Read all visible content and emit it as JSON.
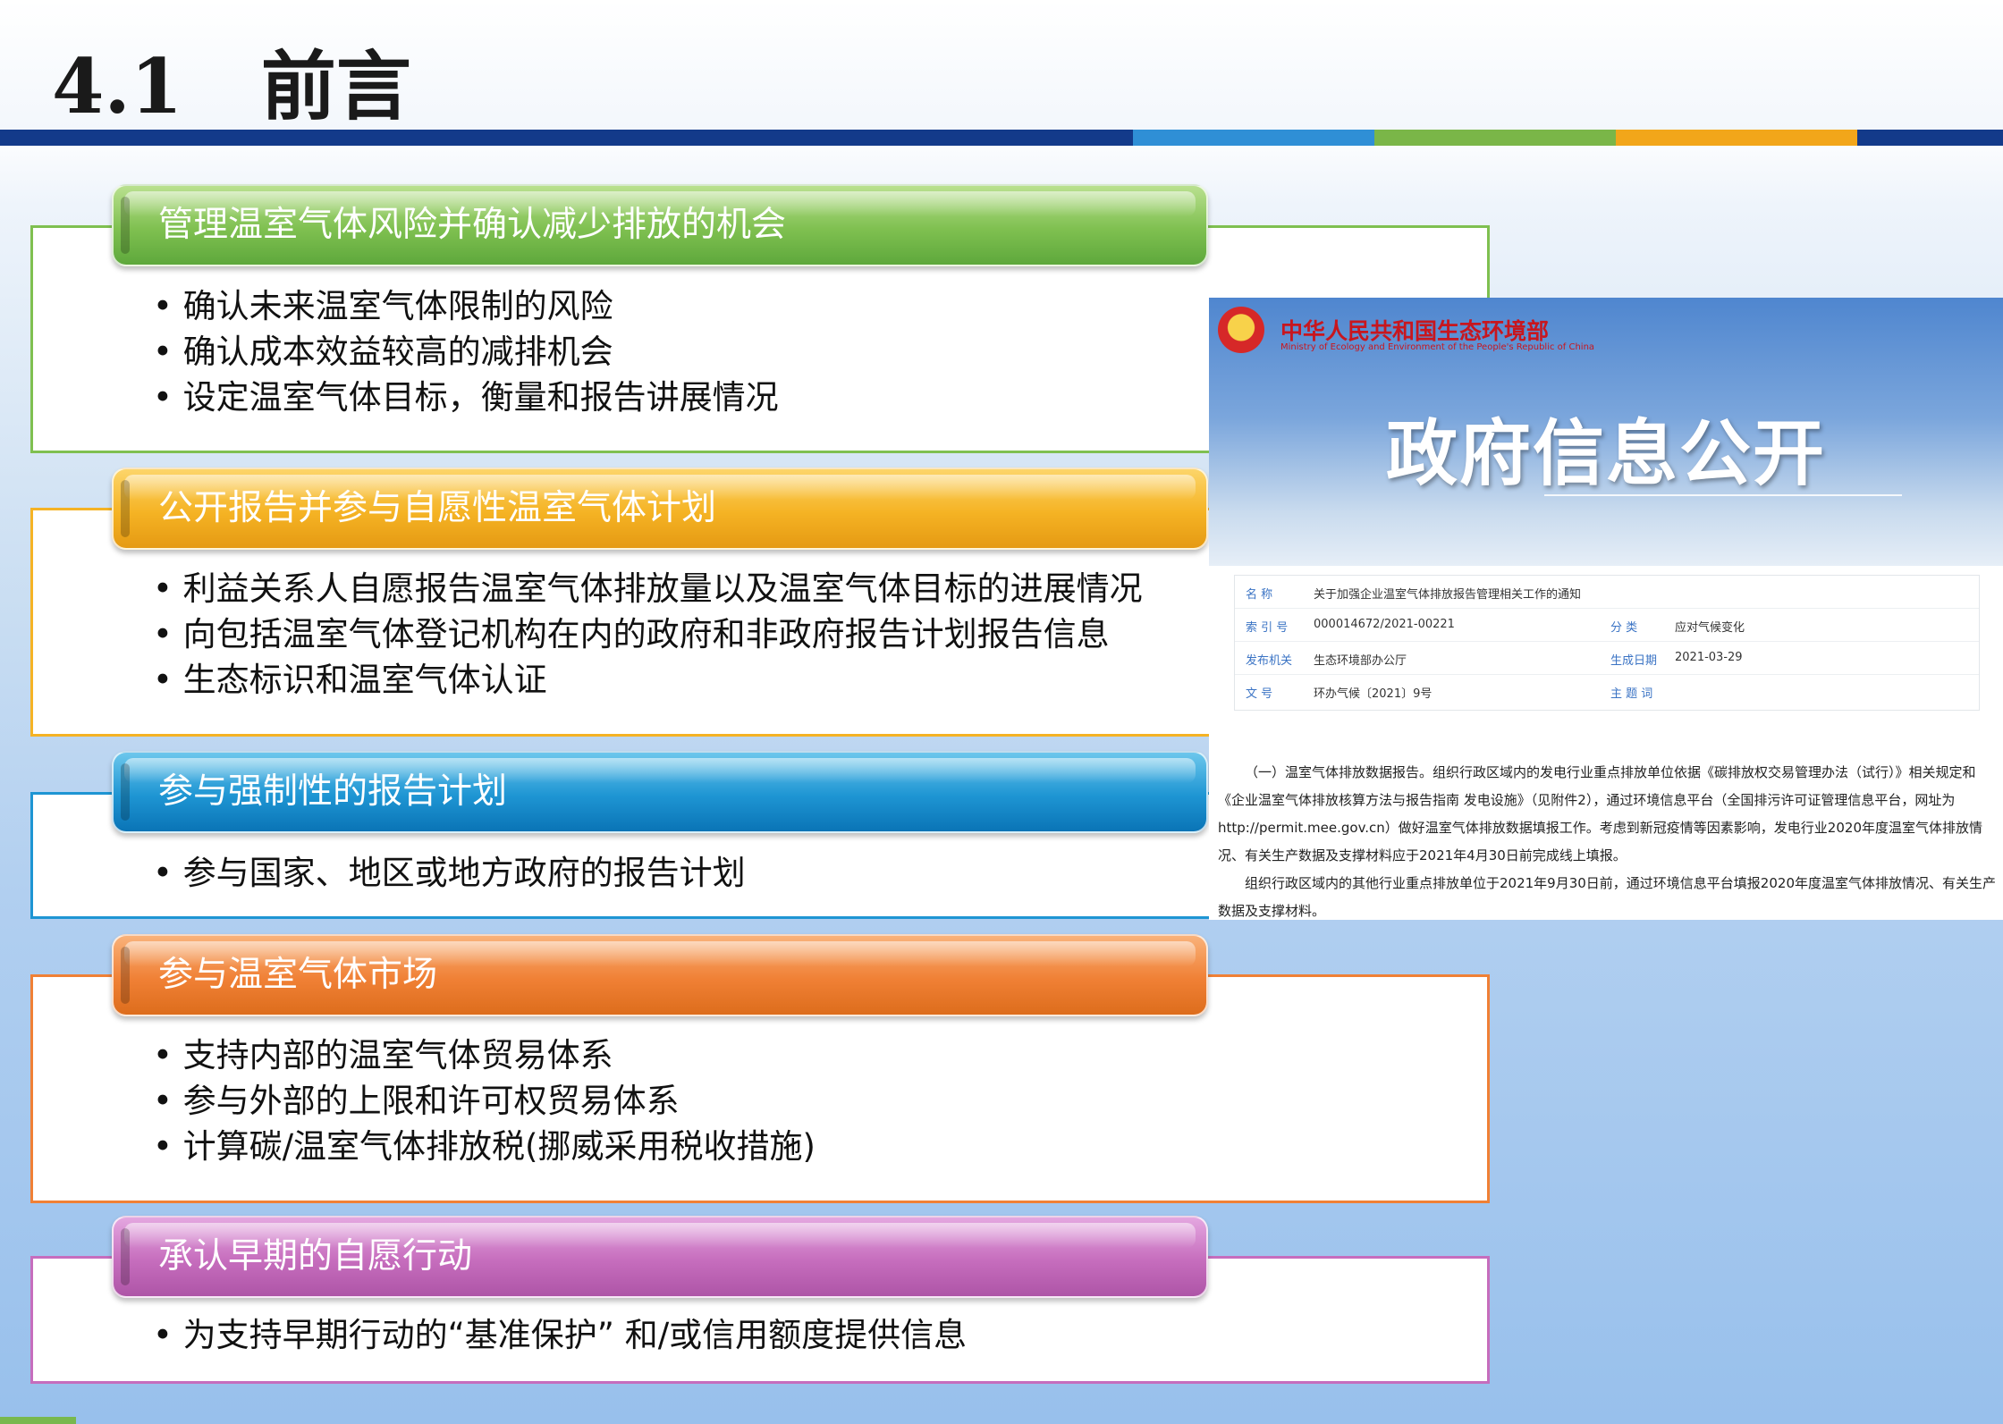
{
  "slide": {
    "title": "4.1   前言",
    "bar_colors": [
      "#133a8a",
      "#2f8fd6",
      "#7ab648",
      "#f2a61a",
      "#133a8a"
    ]
  },
  "sections": [
    {
      "header": "管理温室气体风险并确认减少排放的机会",
      "color": "#7fc050",
      "bullets": [
        "确认未来温室气体限制的风险",
        "确认成本效益较高的减排机会",
        "设定温室气体目标，衡量和报告讲展情况"
      ]
    },
    {
      "header": "公开报告并参与自愿性温室气体计划",
      "color": "#f5b324",
      "bullets": [
        "利益关系人自愿报告温室气体排放量以及温室气体目标的进展情况",
        "向包括温室气体登记机构在内的政府和非政府报告计划报告信息",
        "生态标识和温室气体认证"
      ]
    },
    {
      "header": "参与强制性的报告计划",
      "color": "#1e95d3",
      "bullets": [
        "参与国家、地区或地方政府的报告计划"
      ]
    },
    {
      "header": "参与温室气体市场",
      "color": "#f08035",
      "bullets": [
        "支持内部的温室气体贸易体系",
        "参与外部的上限和许可权贸易体系",
        "计算碳/温室气体排放税(挪威采用税收措施)"
      ]
    },
    {
      "header": "承认早期的自愿行动",
      "color": "#c66dbd",
      "bullets": [
        "为支持早期行动的“基准保护” 和/或信用额度提供信息"
      ]
    }
  ],
  "notice": {
    "ministry_cn": "中华人民共和国生态环境部",
    "ministry_en": "Ministry of Ecology and Environment of the People's Republic of China",
    "banner_title": "政府信息公开",
    "meta": {
      "name_label": "名    称",
      "name_value": "关于加强企业温室气体排放报告管理相关工作的通知",
      "index_label": "索 引 号",
      "index_value": "000014672/2021-00221",
      "category_label": "分    类",
      "category_value": "应对气候变化",
      "issuer_label": "发布机关",
      "issuer_value": "生态环境部办公厅",
      "date_label": "生成日期",
      "date_value": "2021-03-29",
      "doc_label": "文    号",
      "doc_value": "环办气候〔2021〕9号",
      "topic_label": "主 题 词",
      "topic_value": ""
    },
    "body_p1": "（一）温室气体排放数据报告。组织行政区域内的发电行业重点排放单位依据《碳排放权交易管理办法（试行）》相关规定和《企业温室气体排放核算方法与报告指南 发电设施》（见附件2），通过环境信息平台（全国排污许可证管理信息平台，网址为http://permit.mee.gov.cn）做好温室气体排放数据填报工作。考虑到新冠疫情等因素影响，发电行业2020年度温室气体排放情况、有关生产数据及支撑材料应于2021年4月30日前完成线上填报。",
    "body_p2": "组织行政区域内的其他行业重点排放单位于2021年9月30日前，通过环境信息平台填报2020年度温室气体排放情况、有关生产数据及支撑材料。"
  }
}
